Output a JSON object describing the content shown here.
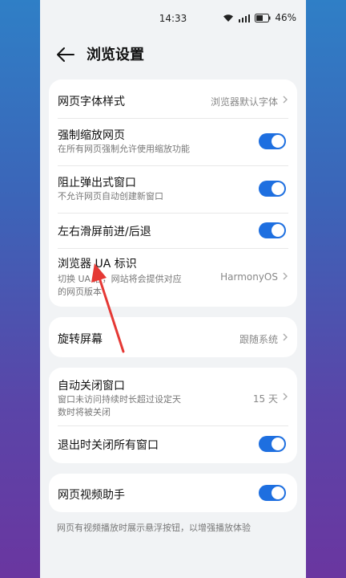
{
  "status_bar": {
    "time": "14:33",
    "battery": "46%"
  },
  "header": {
    "title": "浏览设置"
  },
  "card1": {
    "font_style": {
      "label": "网页字体样式",
      "value": "浏览器默认字体"
    },
    "force_zoom": {
      "label": "强制缩放网页",
      "desc": "在所有网页强制允许使用缩放功能",
      "enabled": true
    },
    "block_popup": {
      "label": "阻止弹出式窗口",
      "desc": "不允许网页自动创建新窗口",
      "enabled": true
    },
    "swipe_nav": {
      "label": "左右滑屏前进/后退",
      "enabled": true
    },
    "ua": {
      "label": "浏览器 UA 标识",
      "desc1": "切换 UA 后，网站将会提供对应",
      "desc2": "的网页版本",
      "value": "HarmonyOS"
    }
  },
  "card2": {
    "rotate": {
      "label": "旋转屏幕",
      "value": "跟随系统"
    }
  },
  "card3": {
    "auto_close": {
      "label": "自动关闭窗口",
      "desc1": "窗口未访问持续时长超过设定天",
      "desc2": "数时将被关闭",
      "value": "15 天"
    },
    "close_on_exit": {
      "label": "退出时关闭所有窗口",
      "enabled": true
    }
  },
  "card4": {
    "video_helper": {
      "label": "网页视频助手",
      "enabled": true
    },
    "footnote": "网页有视频播放时展示悬浮按钮，以增强播放体验"
  },
  "colors": {
    "accent": "#1e6fe0",
    "annotation": "#e53935"
  }
}
